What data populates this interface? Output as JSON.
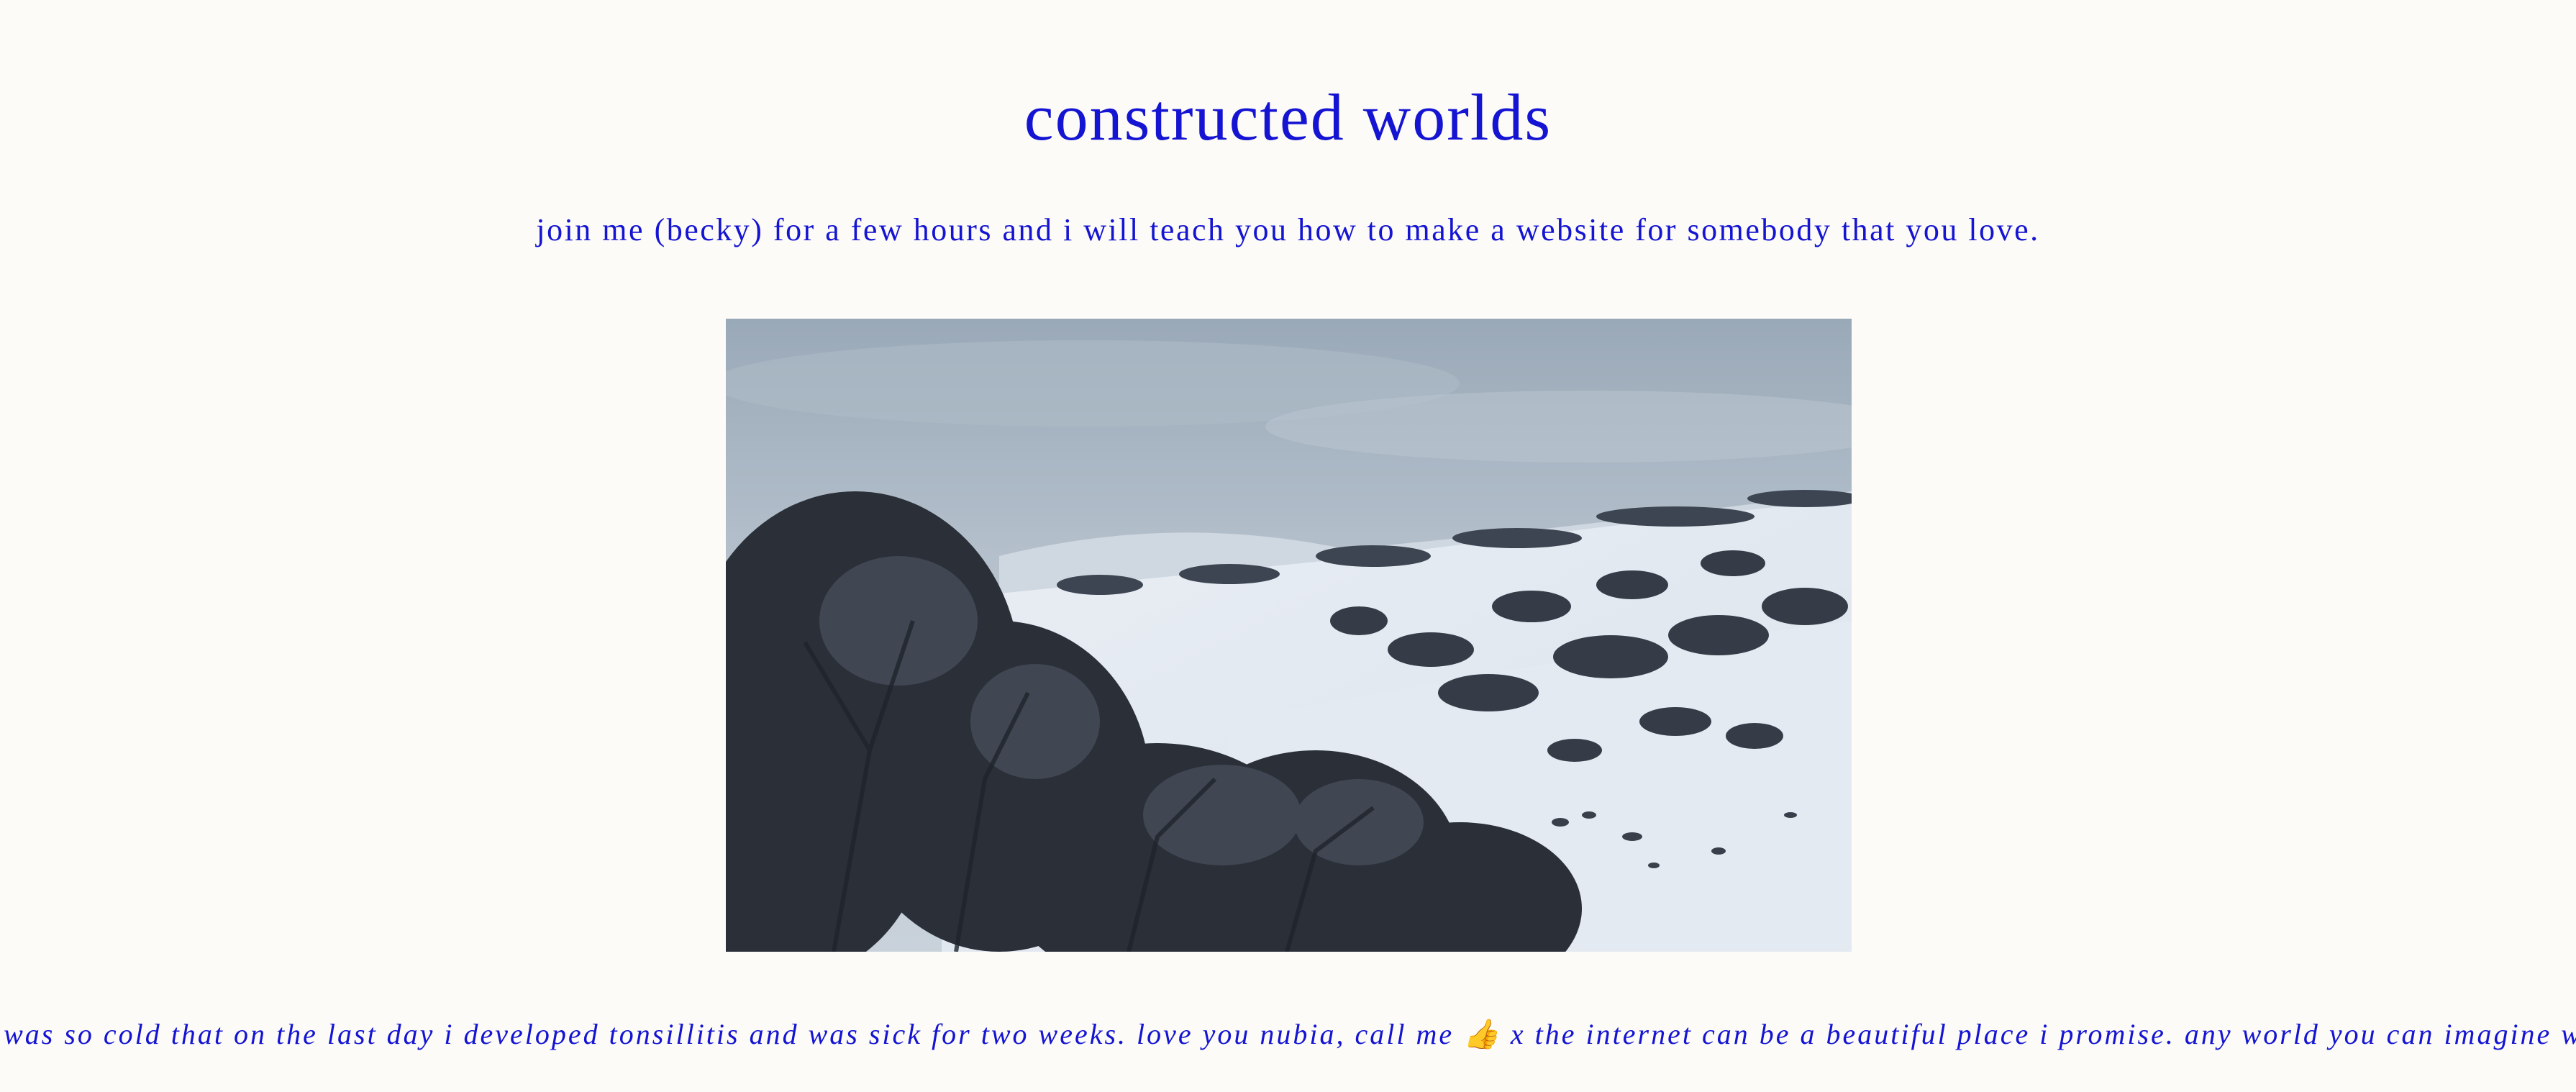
{
  "page": {
    "title": "constructed worlds",
    "intro": "join me (becky) for a few hours and i will teach you how to make a website for somebody that you love."
  },
  "media": {
    "image_subject": "snowy-alpine-hillside-with-trees"
  },
  "ticker": {
    "text": "t was so cold that on the last day i developed tonsillitis and was sick for two weeks. love you nubia, call me 👍 x the internet can be a beautiful place i promise. any world you can imagine we can m"
  },
  "colors": {
    "background": "#fcfbf7",
    "text": "#1414d2"
  }
}
